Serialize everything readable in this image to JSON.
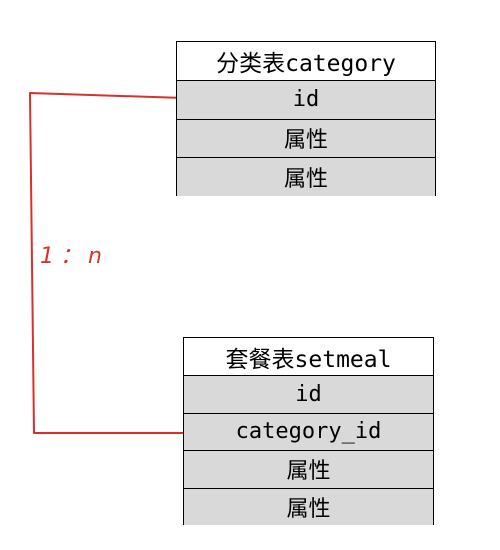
{
  "category_table": {
    "title": "分类表category",
    "rows": [
      "id",
      "属性",
      "属性"
    ]
  },
  "setmeal_table": {
    "title": "套餐表setmeal",
    "rows": [
      "id",
      "category_id",
      "属性",
      "属性"
    ]
  },
  "relationship": {
    "label": "1：n",
    "color": "#d9302c"
  },
  "colors": {
    "cell_fill": "#d9d9d9",
    "header_fill": "#ffffff",
    "border": "#000000"
  }
}
